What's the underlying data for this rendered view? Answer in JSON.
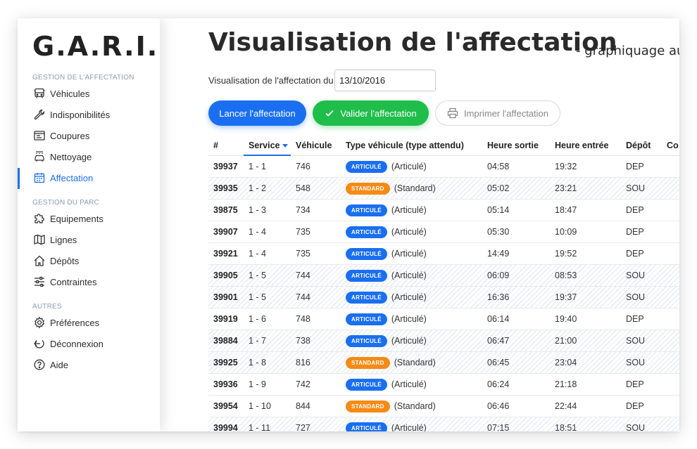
{
  "app": {
    "logo": "G.A.R.I."
  },
  "sidebar": {
    "sections": [
      {
        "title": "GESTION DE L'AFFECTATION"
      },
      {
        "title": "GESTION DU PARC"
      },
      {
        "title": "AUTRES"
      }
    ],
    "items": [
      {
        "label": "Véhicules",
        "icon": "bus-icon"
      },
      {
        "label": "Indisponibilités",
        "icon": "wrench-icon"
      },
      {
        "label": "Coupures",
        "icon": "window-icon"
      },
      {
        "label": "Nettoyage",
        "icon": "car-wash-icon"
      },
      {
        "label": "Affectation",
        "icon": "calendar-icon",
        "active": true
      },
      {
        "label": "Equipements",
        "icon": "puzzle-icon"
      },
      {
        "label": "Lignes",
        "icon": "map-icon"
      },
      {
        "label": "Dépôts",
        "icon": "home-icon"
      },
      {
        "label": "Contraintes",
        "icon": "sliders-icon"
      },
      {
        "label": "Préférences",
        "icon": "gear-icon"
      },
      {
        "label": "Déconnexion",
        "icon": "logout-icon"
      },
      {
        "label": "Aide",
        "icon": "help-icon"
      }
    ]
  },
  "main": {
    "title": "Visualisation de l'affectation",
    "subtitle": "- graphiquage au",
    "date_label": "Visualisation de l'affectation du",
    "date_value": "13/10/2016",
    "buttons": {
      "run": "Lancer l'affectation",
      "validate": "Valider l'affectation",
      "print": "Imprimer l'affectation"
    }
  },
  "colors": {
    "accent": "#1e6fe8",
    "validate": "#1fbd4a",
    "articule_badge": "#1a6ff0",
    "standard_badge": "#f58a16"
  },
  "table": {
    "columns": [
      "#",
      "Service",
      "Véhicule",
      "Type véhicule (type attendu)",
      "Heure sortie",
      "Heure entrée",
      "Dépôt",
      "Co"
    ],
    "sorted_column": "Service",
    "badges": {
      "articule": "ARTICULÉ",
      "standard": "STANDARD"
    },
    "rows": [
      {
        "id": "39937",
        "service": "1 - 1",
        "vehicule": "746",
        "badge": "ARTICULÉ",
        "kind": "articule",
        "type": "(Articulé)",
        "sortie": "04:58",
        "entree": "19:32",
        "depot": "DEP",
        "striped": false
      },
      {
        "id": "39935",
        "service": "1 - 2",
        "vehicule": "548",
        "badge": "STANDARD",
        "kind": "standard",
        "type": "(Standard)",
        "sortie": "05:02",
        "entree": "23:21",
        "depot": "SOU",
        "striped": true
      },
      {
        "id": "39875",
        "service": "1 - 3",
        "vehicule": "734",
        "badge": "ARTICULÉ",
        "kind": "articule",
        "type": "(Articulé)",
        "sortie": "05:14",
        "entree": "18:47",
        "depot": "DEP",
        "striped": false
      },
      {
        "id": "39907",
        "service": "1 - 4",
        "vehicule": "735",
        "badge": "ARTICULÉ",
        "kind": "articule",
        "type": "(Articulé)",
        "sortie": "05:30",
        "entree": "10:09",
        "depot": "DEP",
        "striped": false
      },
      {
        "id": "39921",
        "service": "1 - 4",
        "vehicule": "735",
        "badge": "ARTICULÉ",
        "kind": "articule",
        "type": "(Articulé)",
        "sortie": "14:49",
        "entree": "19:52",
        "depot": "DEP",
        "striped": false
      },
      {
        "id": "39905",
        "service": "1 - 5",
        "vehicule": "744",
        "badge": "ARTICULÉ",
        "kind": "articule",
        "type": "(Articulé)",
        "sortie": "06:09",
        "entree": "08:53",
        "depot": "SOU",
        "striped": true
      },
      {
        "id": "39901",
        "service": "1 - 5",
        "vehicule": "744",
        "badge": "ARTICULÉ",
        "kind": "articule",
        "type": "(Articulé)",
        "sortie": "16:36",
        "entree": "19:37",
        "depot": "SOU",
        "striped": true
      },
      {
        "id": "39919",
        "service": "1 - 6",
        "vehicule": "748",
        "badge": "ARTICULÉ",
        "kind": "articule",
        "type": "(Articulé)",
        "sortie": "06:14",
        "entree": "19:40",
        "depot": "DEP",
        "striped": false
      },
      {
        "id": "39884",
        "service": "1 - 7",
        "vehicule": "738",
        "badge": "ARTICULÉ",
        "kind": "articule",
        "type": "(Articulé)",
        "sortie": "06:47",
        "entree": "21:00",
        "depot": "SOU",
        "striped": true
      },
      {
        "id": "39925",
        "service": "1 - 8",
        "vehicule": "816",
        "badge": "STANDARD",
        "kind": "standard",
        "type": "(Standard)",
        "sortie": "06:45",
        "entree": "23:04",
        "depot": "SOU",
        "striped": true
      },
      {
        "id": "39936",
        "service": "1 - 9",
        "vehicule": "742",
        "badge": "ARTICULÉ",
        "kind": "articule",
        "type": "(Articulé)",
        "sortie": "06:24",
        "entree": "21:18",
        "depot": "DEP",
        "striped": false
      },
      {
        "id": "39954",
        "service": "1 - 10",
        "vehicule": "844",
        "badge": "STANDARD",
        "kind": "standard",
        "type": "(Standard)",
        "sortie": "06:46",
        "entree": "22:44",
        "depot": "DEP",
        "striped": false
      },
      {
        "id": "39994",
        "service": "1 - 11",
        "vehicule": "727",
        "badge": "ARTICULÉ",
        "kind": "articule",
        "type": "(Articulé)",
        "sortie": "07:15",
        "entree": "18:51",
        "depot": "SOU",
        "striped": true
      }
    ]
  }
}
